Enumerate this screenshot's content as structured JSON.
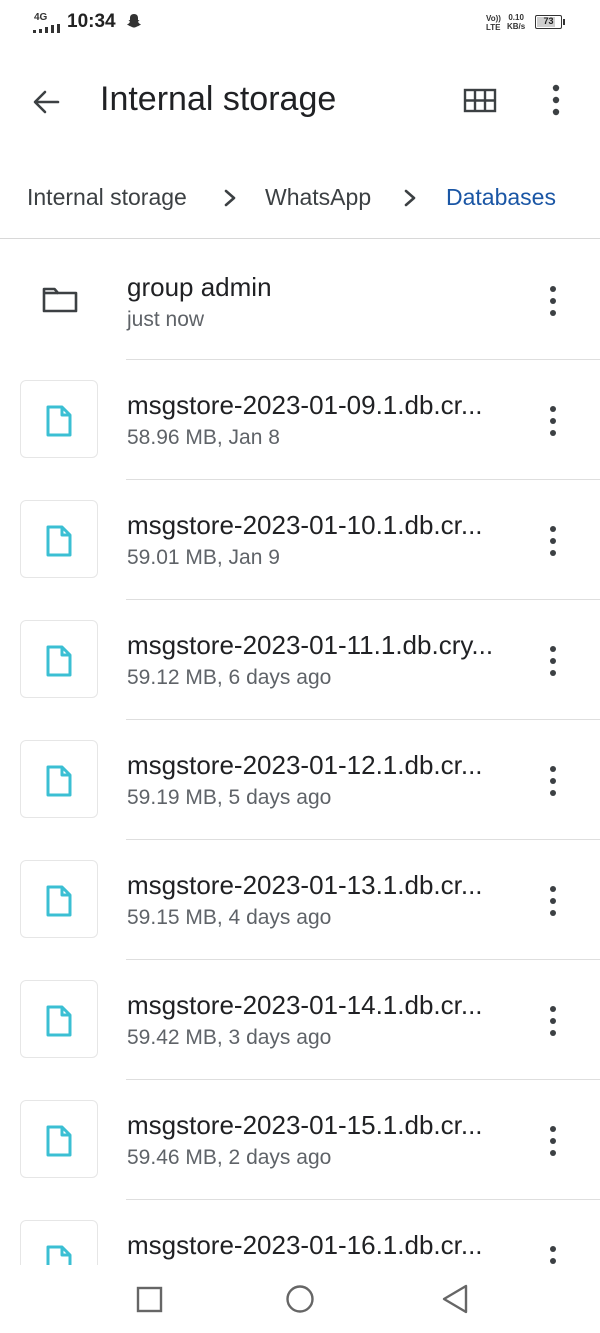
{
  "status_bar": {
    "network": "4G",
    "time": "10:34",
    "volte": "Vo))",
    "lte": "LTE",
    "speed_value": "0.10",
    "speed_unit": "KB/s",
    "battery": "73"
  },
  "app_bar": {
    "title": "Internal storage",
    "back_icon": "arrow-left-icon",
    "grid_icon": "grid-view-icon",
    "more_icon": "more-vert-icon"
  },
  "breadcrumb": {
    "items": [
      "Internal storage",
      "WhatsApp",
      "Databases"
    ]
  },
  "files": [
    {
      "type": "folder",
      "name": "group admin",
      "meta": "just now"
    },
    {
      "type": "file",
      "name": "msgstore-2023-01-09.1.db.cr...",
      "meta": "58.96 MB, Jan 8"
    },
    {
      "type": "file",
      "name": "msgstore-2023-01-10.1.db.cr...",
      "meta": "59.01 MB, Jan 9"
    },
    {
      "type": "file",
      "name": "msgstore-2023-01-11.1.db.cry...",
      "meta": "59.12 MB, 6 days ago"
    },
    {
      "type": "file",
      "name": "msgstore-2023-01-12.1.db.cr...",
      "meta": "59.19 MB, 5 days ago"
    },
    {
      "type": "file",
      "name": "msgstore-2023-01-13.1.db.cr...",
      "meta": "59.15 MB, 4 days ago"
    },
    {
      "type": "file",
      "name": "msgstore-2023-01-14.1.db.cr...",
      "meta": "59.42 MB, 3 days ago"
    },
    {
      "type": "file",
      "name": "msgstore-2023-01-15.1.db.cr...",
      "meta": "59.46 MB, 2 days ago"
    },
    {
      "type": "file",
      "name": "msgstore-2023-01-16.1.db.cr...",
      "meta": ""
    }
  ],
  "colors": {
    "accent": "#1a56a5",
    "file_icon": "#3bbfd3"
  },
  "nav": {
    "recents_icon": "square-icon",
    "home_icon": "circle-icon",
    "back_icon": "triangle-back-icon"
  }
}
